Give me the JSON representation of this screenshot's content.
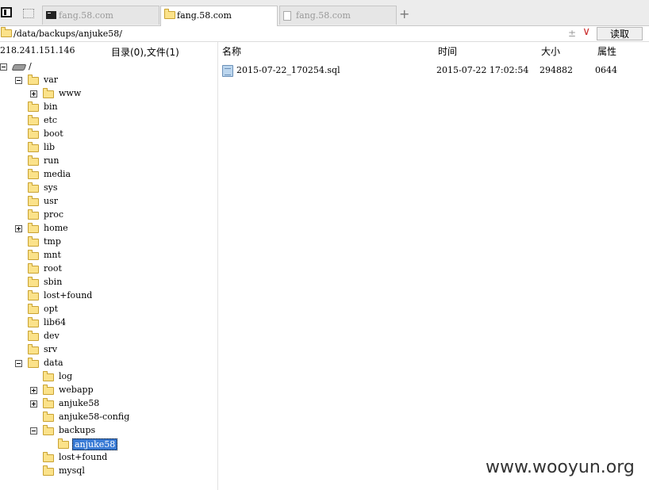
{
  "tabs": [
    {
      "label": "fang.58.com",
      "icon": "terminal-icon",
      "active": false
    },
    {
      "label": "fang.58.com",
      "icon": "folder-icon",
      "active": true
    },
    {
      "label": "fang.58.com",
      "icon": "page-icon",
      "active": false
    }
  ],
  "new_tab_label": "+",
  "address": {
    "path": "/data/backups/anjuke58/",
    "bookmark_glyph": "±",
    "dropdown_glyph": "∨",
    "read_button": "读取"
  },
  "server": {
    "ip": "218.241.151.146",
    "summary": "目录(0),文件(1)"
  },
  "columns": {
    "name": "名称",
    "time": "时间",
    "size": "大小",
    "attr": "属性"
  },
  "files": [
    {
      "name": "2015-07-22_170254.sql",
      "time": "2015-07-22 17:02:54",
      "size": "294882",
      "attr": "0644"
    }
  ],
  "tree": {
    "root": "/",
    "var": "var",
    "www": "www",
    "bin": "bin",
    "etc": "etc",
    "boot": "boot",
    "lib": "lib",
    "run": "run",
    "media": "media",
    "sys": "sys",
    "usr": "usr",
    "proc": "proc",
    "home": "home",
    "tmp": "tmp",
    "mnt": "mnt",
    "rootdir": "root",
    "sbin": "sbin",
    "lost_found": "lost+found",
    "opt": "opt",
    "lib64": "lib64",
    "dev": "dev",
    "srv": "srv",
    "data": "data",
    "log": "log",
    "webapp": "webapp",
    "anjuke58": "anjuke58",
    "anjuke58_config": "anjuke58-config",
    "backups": "backups",
    "anjuke58_sel": "anjuke58",
    "data_lost_found": "lost+found",
    "mysql": "mysql"
  },
  "watermark": "www.wooyun.org"
}
